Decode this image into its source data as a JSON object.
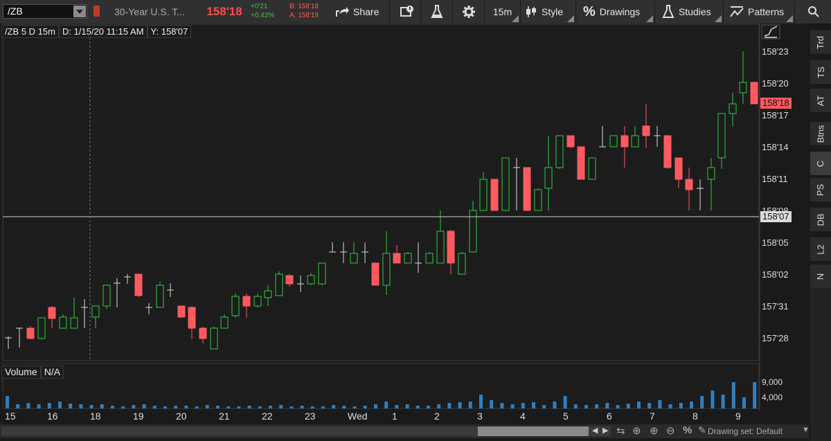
{
  "toolbar": {
    "symbol": "/ZB",
    "description": "30-Year U.S. T...",
    "last": "158'18",
    "net_change": "+0'21",
    "pct_change": "+0.42%",
    "bid": "B: 158'18",
    "ask": "A: 158'19",
    "share": "Share",
    "timeframe": "15m",
    "style": "Style",
    "drawings": "Drawings",
    "studies": "Studies",
    "patterns": "Patterns"
  },
  "chart_header": {
    "symbol_period": "/ZB 5 D 15m",
    "date": "D: 1/15/20 11:15 AM",
    "y_value": "Y: 158'07"
  },
  "volume_header": {
    "label": "Volume",
    "value": "N/A"
  },
  "right_tabs": [
    "Trd",
    "TS",
    "AT",
    "Btns",
    "C",
    "PS",
    "DB",
    "L2",
    "N"
  ],
  "price_axis": {
    "labels": [
      "158'23",
      "158'20",
      "158'17",
      "158'14",
      "158'11",
      "158'08",
      "158'05",
      "158'02",
      "157'31",
      "157'28"
    ],
    "current_price_tag": "158'18",
    "crosshair_price_tag": "158'07",
    "colors": {
      "up": "#2ecc40",
      "down": "#ff5a5f",
      "current_tag_bg": "#ff5a5f",
      "crosshair_tag_bg": "#dcdcdc"
    }
  },
  "volume_axis": {
    "labels": [
      "9,000",
      "4,000"
    ]
  },
  "time_axis": {
    "labels": [
      "15",
      "16",
      "18",
      "19",
      "20",
      "21",
      "22",
      "23",
      "Wed",
      "1",
      "2",
      "3",
      "4",
      "5",
      "6",
      "7",
      "8",
      "9"
    ]
  },
  "status": {
    "drawing_set": "Drawing set: Default"
  }
}
